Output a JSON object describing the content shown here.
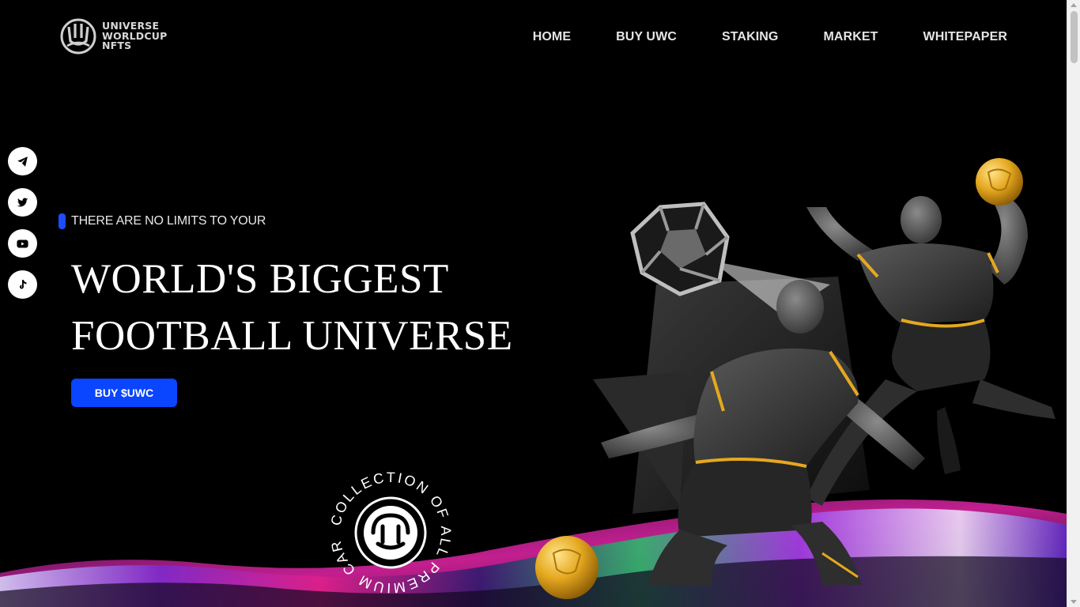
{
  "brand": {
    "lines": [
      "UNIVERSE",
      "WORLDCUP",
      "NFTS"
    ]
  },
  "nav": [
    {
      "label": "HOME"
    },
    {
      "label": "BUY UWC"
    },
    {
      "label": "STAKING"
    },
    {
      "label": "MARKET"
    },
    {
      "label": "WHITEPAPER"
    }
  ],
  "social": [
    {
      "icon": "telegram-icon"
    },
    {
      "icon": "twitter-icon"
    },
    {
      "icon": "youtube-icon"
    },
    {
      "icon": "tiktok-icon"
    }
  ],
  "hero": {
    "eyebrow": "THERE ARE NO LIMITS TO YOUR",
    "headline_line1": "WORLD'S BIGGEST",
    "headline_line2": "FOOTBALL UNIVERSE",
    "cta_label": "BUY $UWC"
  },
  "badge": {
    "ring_text": "COLLECTION OF ALL PREMIUM CARD · "
  },
  "colors": {
    "background": "#000000",
    "accent_blue": "#0a45ff",
    "eyebrow_bar": "#1e4cff",
    "gold": "#e5a81f"
  }
}
